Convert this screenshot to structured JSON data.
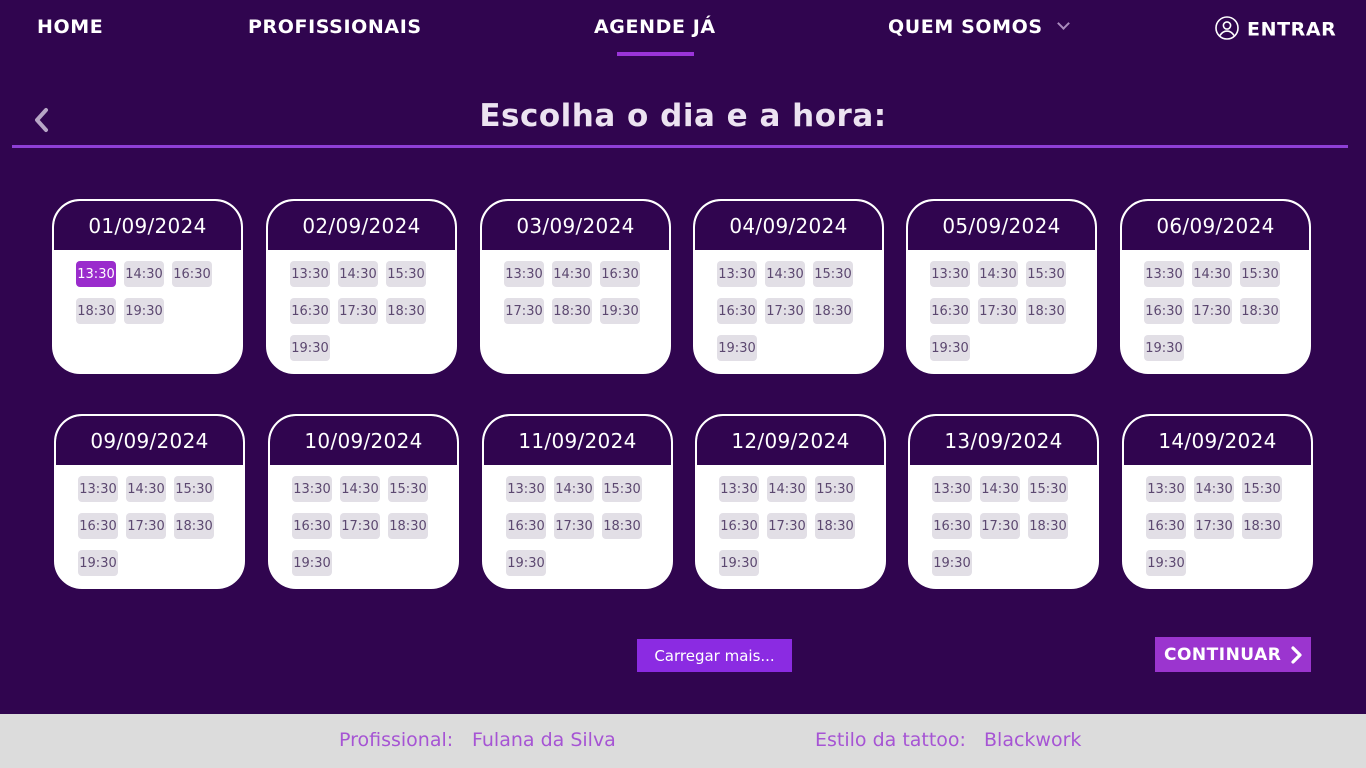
{
  "nav": {
    "home": "HOME",
    "professionals": "PROFISSIONAIS",
    "schedule": "AGENDE JÁ",
    "about": "QUEM SOMOS",
    "login": "ENTRAR"
  },
  "page": {
    "title": "Escolha o dia e a hora:"
  },
  "days": [
    {
      "date": "01/09/2024",
      "slots": [
        "13:30",
        "14:30",
        "16:30",
        "18:30",
        "19:30"
      ],
      "selected": 0
    },
    {
      "date": "02/09/2024",
      "slots": [
        "13:30",
        "14:30",
        "15:30",
        "16:30",
        "17:30",
        "18:30",
        "19:30"
      ]
    },
    {
      "date": "03/09/2024",
      "slots": [
        "13:30",
        "14:30",
        "16:30",
        "17:30",
        "18:30",
        "19:30"
      ]
    },
    {
      "date": "04/09/2024",
      "slots": [
        "13:30",
        "14:30",
        "15:30",
        "16:30",
        "17:30",
        "18:30",
        "19:30"
      ]
    },
    {
      "date": "05/09/2024",
      "slots": [
        "13:30",
        "14:30",
        "15:30",
        "16:30",
        "17:30",
        "18:30",
        "19:30"
      ]
    },
    {
      "date": "06/09/2024",
      "slots": [
        "13:30",
        "14:30",
        "15:30",
        "16:30",
        "17:30",
        "18:30",
        "19:30"
      ]
    },
    {
      "date": "09/09/2024",
      "slots": [
        "13:30",
        "14:30",
        "15:30",
        "16:30",
        "17:30",
        "18:30",
        "19:30"
      ]
    },
    {
      "date": "10/09/2024",
      "slots": [
        "13:30",
        "14:30",
        "15:30",
        "16:30",
        "17:30",
        "18:30",
        "19:30"
      ]
    },
    {
      "date": "11/09/2024",
      "slots": [
        "13:30",
        "14:30",
        "15:30",
        "16:30",
        "17:30",
        "18:30",
        "19:30"
      ]
    },
    {
      "date": "12/09/2024",
      "slots": [
        "13:30",
        "14:30",
        "15:30",
        "16:30",
        "17:30",
        "18:30",
        "19:30"
      ]
    },
    {
      "date": "13/09/2024",
      "slots": [
        "13:30",
        "14:30",
        "15:30",
        "16:30",
        "17:30",
        "18:30",
        "19:30"
      ]
    },
    {
      "date": "14/09/2024",
      "slots": [
        "13:30",
        "14:30",
        "15:30",
        "16:30",
        "17:30",
        "18:30",
        "19:30"
      ]
    }
  ],
  "actions": {
    "load_more": "Carregar mais...",
    "continue": "CONTINUAR"
  },
  "footer": {
    "professional_label": "Profissional:",
    "professional_value": "Fulana da Silva",
    "style_label": "Estilo da tattoo:",
    "style_value": "Blackwork"
  },
  "colors": {
    "background": "#30054f",
    "accent": "#9a34d9",
    "selected_slot": "#9a2ccc",
    "footer_text": "#a654d4"
  },
  "icons": {
    "back": "chevron-left-icon",
    "dropdown": "chevron-down-icon",
    "user": "user-circle-icon",
    "continue": "chevron-right-icon"
  }
}
